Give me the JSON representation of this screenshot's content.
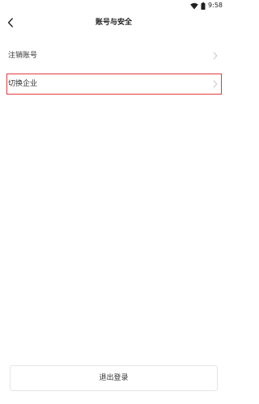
{
  "status_bar": {
    "time": "9:58",
    "wifi_icon": "wifi-icon",
    "battery_icon": "battery-icon"
  },
  "header": {
    "title": "账号与安全",
    "back_icon": "chevron-left-icon"
  },
  "menu": {
    "items": [
      {
        "label": "注销账号",
        "icon": "chevron-right-icon"
      },
      {
        "label": "切换企业",
        "icon": "chevron-right-icon",
        "highlighted": true
      }
    ]
  },
  "footer": {
    "logout_label": "退出登录"
  },
  "colors": {
    "highlight": "#e23a3a",
    "text": "#333333",
    "chevron": "#c8c8c8",
    "button_border": "#e5e5e5"
  }
}
